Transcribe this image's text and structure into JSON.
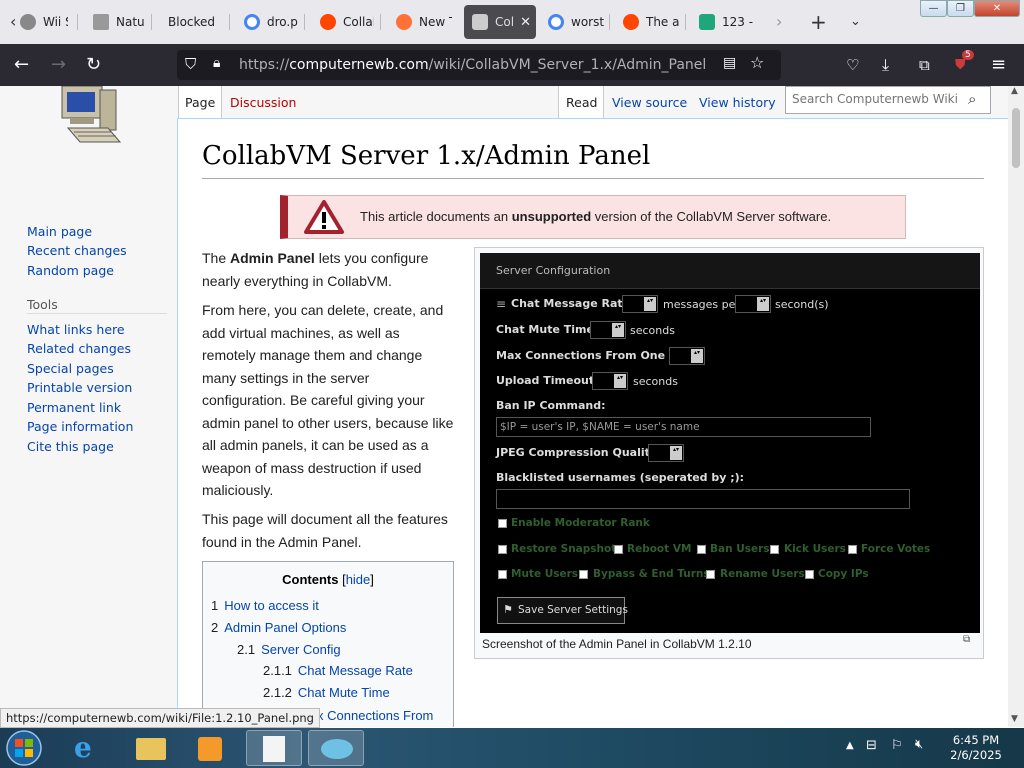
{
  "browser": {
    "tabs": [
      {
        "label": "Wii S",
        "color": "#888"
      },
      {
        "label": "Natur",
        "color": "#999"
      },
      {
        "label": "Blocked",
        "color": ""
      },
      {
        "label": "dro.p",
        "color": "#4285f4"
      },
      {
        "label": "Collal",
        "color": "#ff4500"
      },
      {
        "label": "New T",
        "color": "#ff7139"
      },
      {
        "label": "Col",
        "color": "#ccc"
      },
      {
        "label": "worst",
        "color": "#4285f4"
      },
      {
        "label": "The a",
        "color": "#ff4500"
      },
      {
        "label": "123 -",
        "color": "#1fa67a"
      }
    ],
    "url_prefix": "https://",
    "url_host": "computernewb.com",
    "url_path": "/wiki/CollabVM_Server_1.x/Admin_Panel",
    "extension_badge": "5"
  },
  "wiki": {
    "sidebar": {
      "nav": [
        "Main page",
        "Recent changes",
        "Random page"
      ],
      "tools_label": "Tools",
      "tools": [
        "What links here",
        "Related changes",
        "Special pages",
        "Printable version",
        "Permanent link",
        "Page information",
        "Cite this page"
      ]
    },
    "tabs": {
      "page": "Page",
      "discussion": "Discussion",
      "read": "Read",
      "view_source": "View source",
      "view_history": "View history"
    },
    "search_placeholder": "Search Computernewb Wiki",
    "title": "CollabVM Server 1.x/Admin Panel",
    "notice": {
      "before": "This article documents an ",
      "bold": "unsupported",
      "after": " version of the CollabVM Server software."
    },
    "intro": {
      "p1_pre": "The ",
      "p1_bold": "Admin Panel",
      "p1_post": " lets you configure nearly everything in CollabVM.",
      "p2": "From here, you can delete, create, and add virtual machines, as well as remotely manage them and change many settings in the server configuration. Be careful giving your admin panel to other users, because like all admin panels, it can be used as a weapon of mass destruction if used maliciously.",
      "p3": "This page will document all the features found in the Admin Panel."
    },
    "toc": {
      "title": "Contents",
      "hide": "hide",
      "items": [
        {
          "num": "1",
          "text": "How to access it"
        },
        {
          "num": "2",
          "text": "Admin Panel Options"
        },
        {
          "num": "2.1",
          "text": "Server Config"
        },
        {
          "num": "2.1.1",
          "text": "Chat Message Rate"
        },
        {
          "num": "2.1.2",
          "text": "Chat Mute Time"
        },
        {
          "num": "",
          "text": "Max Connections From"
        }
      ]
    },
    "figure": {
      "header": "Server Configuration",
      "chat_rate_label": "Chat Message Rate:",
      "messages_per": "messages per",
      "seconds_paren": "second(s)",
      "mute_label": "Chat Mute Time:",
      "seconds": "seconds",
      "max_conn_label": "Max Connections From One IP:",
      "upload_label": "Upload Timeout:",
      "ban_label": "Ban IP Command:",
      "ban_placeholder": "$IP = user's IP, $NAME = user's name",
      "jpeg_label": "JPEG Compression Quality:",
      "blacklist_label": "Blacklisted usernames (seperated by ;):",
      "mod_rank": "Enable Moderator Rank",
      "perms_row1": [
        "Restore Snapshot",
        "Reboot VM",
        "Ban Users",
        "Kick Users",
        "Force Votes"
      ],
      "perms_row2": [
        "Mute Users",
        "Bypass & End Turns",
        "Rename Users",
        "Copy IPs"
      ],
      "save_button": "Save Server Settings",
      "caption": "Screenshot of the Admin Panel in CollabVM 1.2.10"
    }
  },
  "status_url": "https://computernewb.com/wiki/File:1.2.10_Panel.png",
  "taskbar": {
    "time": "6:45 PM",
    "date": "2/6/2025"
  }
}
